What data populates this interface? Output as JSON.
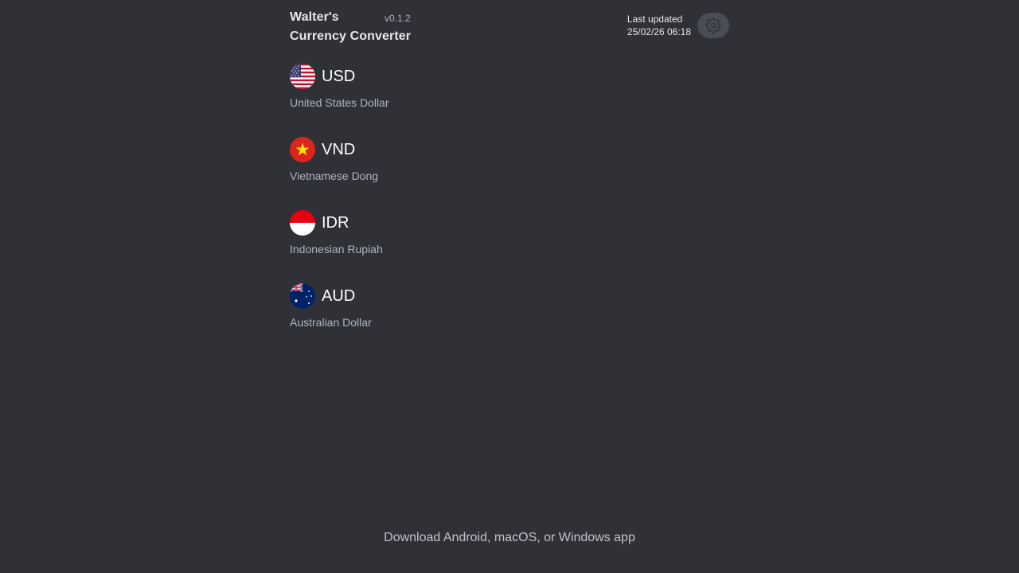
{
  "header": {
    "title_line1": "Walter's",
    "title_line2": "Currency Converter",
    "version": "v0.1.2",
    "last_updated_label": "Last updated",
    "last_updated_value": "25/02/26 06:18",
    "settings_icon": "gear-icon"
  },
  "currencies": [
    {
      "code": "USD",
      "name": "United States Dollar",
      "flag_icon": "us-flag-icon"
    },
    {
      "code": "VND",
      "name": "Vietnamese Dong",
      "flag_icon": "vn-flag-icon"
    },
    {
      "code": "IDR",
      "name": "Indonesian Rupiah",
      "flag_icon": "id-flag-icon"
    },
    {
      "code": "AUD",
      "name": "Australian Dollar",
      "flag_icon": "au-flag-icon"
    }
  ],
  "footer": {
    "download_text": "Download Android, macOS, or Windows app"
  },
  "colors": {
    "background": "#2f3136",
    "text_primary": "#ffffff",
    "text_secondary": "#aeb4c0",
    "settings_button_bg": "#4a4d53"
  }
}
